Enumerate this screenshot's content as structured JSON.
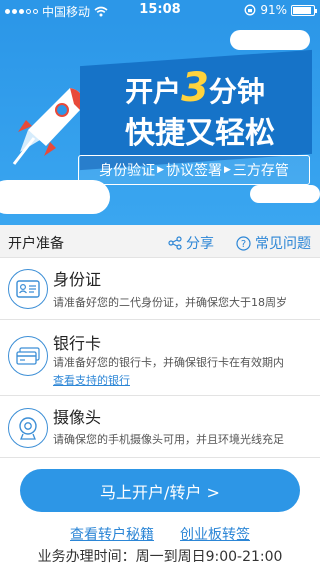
{
  "status_bar": {
    "carrier": "中国移动",
    "time": "15:08",
    "battery": "91%",
    "battery_level": 0.91
  },
  "banner": {
    "title_part1": "开户",
    "title_number": "3",
    "title_part2": "分钟",
    "title_line2": "快捷又轻松",
    "steps": [
      "身份验证",
      "协议签署",
      "三方存管"
    ]
  },
  "section": {
    "title": "开户准备",
    "share_label": "分享",
    "faq_label": "常见问题"
  },
  "items": [
    {
      "name": "身份证",
      "desc": "请准备好您的二代身份证，并确保您大于18周岁"
    },
    {
      "name": "银行卡",
      "desc": "请准备好您的银行卡，并确保银行卡在有效期内",
      "link": "查看支持的银行"
    },
    {
      "name": "摄像头",
      "desc": "请确保您的手机摄像头可用，并且环境光线充足"
    }
  ],
  "main_button": "马上开户/转户 >",
  "bottom_links": [
    "查看转户秘籍",
    "创业板转签"
  ],
  "hours": "业务办理时间：周一到周日9:00-21:00",
  "colors": {
    "primary": "#2c97e8",
    "link": "#2c86d6",
    "title_box": "#1673c8",
    "accent_yellow": "#ffd33d"
  }
}
